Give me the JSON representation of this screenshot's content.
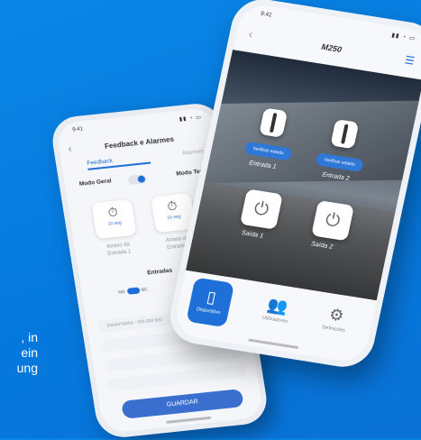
{
  "caption": {
    "lines": [
      ", in",
      "ein",
      "ung"
    ]
  },
  "left_phone": {
    "status_time": "9:41",
    "title": "Feedback e Alarmes",
    "tabs": [
      "Feedback",
      "Alarmes"
    ],
    "mode_left": "Modo Geral",
    "mode_right": "Modo Tempo",
    "timers": [
      {
        "value": "10 seg",
        "label_line1": "Atraso da",
        "label_line2": "Entrada 1"
      },
      {
        "value": "10 seg",
        "label_line1": "Atraso da",
        "label_line2": "Entrada 2"
      }
    ],
    "entradas_title": "Entradas",
    "contact_left": {
      "a": "NO",
      "b": "NC"
    },
    "contact_right": {
      "a": "NO"
    },
    "field_placeholder": "Daniel Narbe - 500 000 000",
    "save_button": "GUARDAR"
  },
  "right_phone": {
    "status_time": "9:41",
    "title": "M250",
    "verify_buttons": [
      "Verificar estado",
      "Verificar estado"
    ],
    "inputs": [
      "Entrada 1",
      "Entrada 2"
    ],
    "outputs": [
      "Saída 1",
      "Saída 2"
    ],
    "nav": [
      {
        "label": "Dispositivo",
        "icon": "remote-icon",
        "active": true
      },
      {
        "label": "Utilizadores",
        "icon": "users-icon",
        "active": false
      },
      {
        "label": "Definições",
        "icon": "gear-icon",
        "active": false
      }
    ],
    "accent_color": "#1e6fd8"
  }
}
